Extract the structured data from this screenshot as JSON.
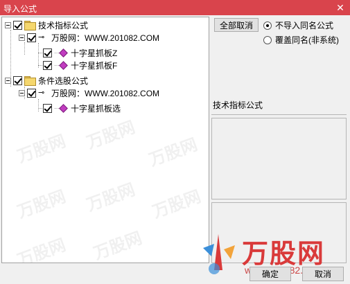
{
  "window": {
    "title": "导入公式",
    "close_glyph": "✕"
  },
  "tree": {
    "groups": [
      {
        "label": "技术指标公式",
        "checked": true,
        "children": [
          {
            "label": "万股网：WWW.201082.COM",
            "checked": true,
            "items": [
              {
                "label": "十字星抓板Z",
                "checked": true
              },
              {
                "label": "十字星抓板F",
                "checked": true
              }
            ]
          }
        ]
      },
      {
        "label": "条件选股公式",
        "checked": true,
        "children": [
          {
            "label": "万股网：WWW.201082.COM",
            "checked": true,
            "items": [
              {
                "label": "十字星抓板选",
                "checked": true
              }
            ]
          }
        ]
      }
    ]
  },
  "options": {
    "cancel_all_label": "全部取消",
    "radio_skip_label": "不导入同名公式",
    "radio_overwrite_label": "覆盖同名(非系统)",
    "selected": "skip"
  },
  "detail": {
    "type_label": "技术指标公式"
  },
  "footer": {
    "ok_label": "确定",
    "cancel_label": "取消"
  },
  "branding": {
    "logo_text": "万股网",
    "logo_url": "www.201082.com",
    "watermark_text": "万股网",
    "accent": "#d93a3a",
    "titlebar_color": "#d9444c"
  }
}
